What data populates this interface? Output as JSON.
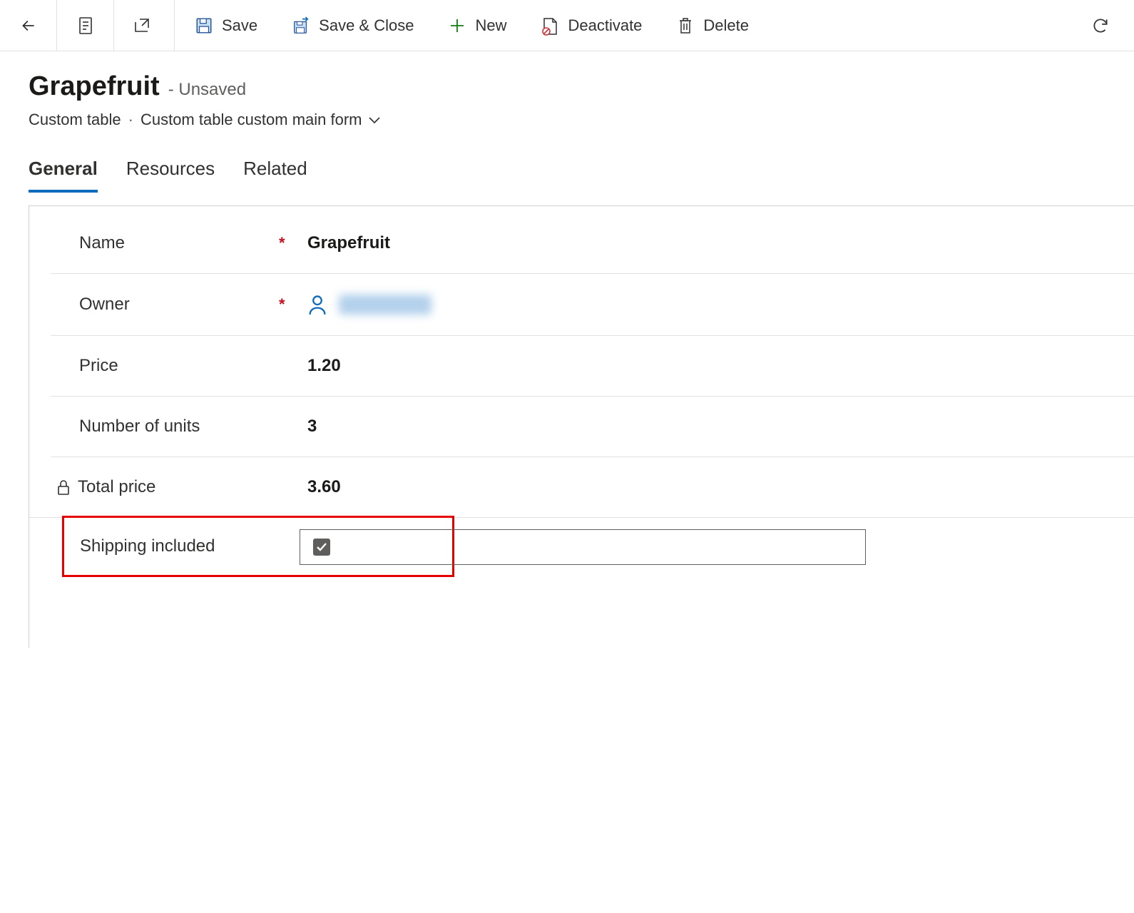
{
  "toolbar": {
    "save_label": "Save",
    "save_close_label": "Save & Close",
    "new_label": "New",
    "deactivate_label": "Deactivate",
    "delete_label": "Delete"
  },
  "header": {
    "title": "Grapefruit",
    "status": "- Unsaved",
    "entity": "Custom table",
    "form_name": "Custom table custom main form"
  },
  "tabs": [
    {
      "label": "General",
      "active": true
    },
    {
      "label": "Resources",
      "active": false
    },
    {
      "label": "Related",
      "active": false
    }
  ],
  "fields": {
    "name": {
      "label": "Name",
      "value": "Grapefruit",
      "required": true
    },
    "owner": {
      "label": "Owner",
      "required": true
    },
    "price": {
      "label": "Price",
      "value": "1.20"
    },
    "units": {
      "label": "Number of units",
      "value": "3"
    },
    "total": {
      "label": "Total price",
      "value": "3.60",
      "locked": true
    },
    "shipping": {
      "label": "Shipping included",
      "checked": true
    }
  }
}
